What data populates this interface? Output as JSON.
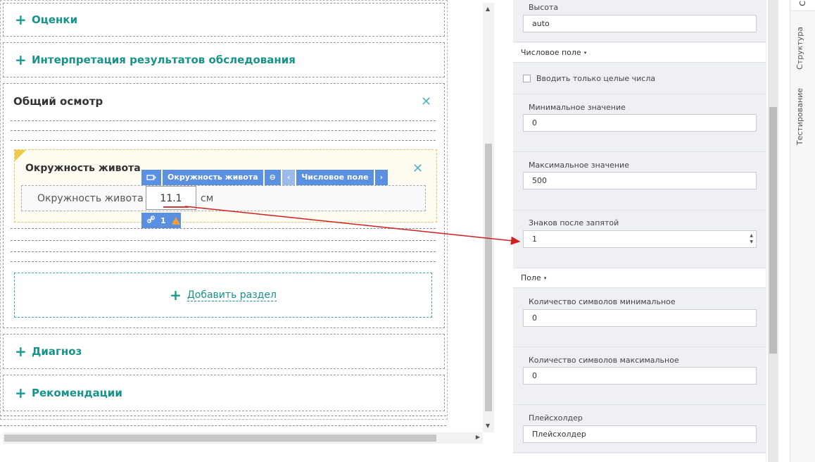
{
  "canvas": {
    "sections": [
      {
        "id": "ocenki",
        "plus": "+",
        "title": "Оценки"
      },
      {
        "id": "interpretation",
        "plus": "+",
        "title": "Интерпретация результатов обследования"
      },
      {
        "id": "diagnoz",
        "plus": "+",
        "title": "Диагноз"
      },
      {
        "id": "recommendations",
        "plus": "+",
        "title": "Рекомендации"
      }
    ],
    "general_exam": {
      "title": "Общий осмотр",
      "close": "✕",
      "field_block": {
        "title": "Окружность живота",
        "close": "✕",
        "row_label": "Окружность живота",
        "input_value": "11.1",
        "unit": "см"
      },
      "add_section": {
        "plus": "+",
        "label": "Добавить раздел"
      }
    },
    "toolbar": {
      "tag_icon": "tag-icon",
      "field_name": "Окружность живота",
      "minus_icon": "⊖",
      "prev_icon": "‹",
      "field_type": "Числовое поле",
      "next_icon": "›"
    },
    "badge": {
      "link_icon": "link-icon",
      "count": "1",
      "warning_icon": "warning-icon"
    },
    "accent_color": "#17948a",
    "toolbar_color": "#5b8fe0",
    "arrow_color": "#cc2222"
  },
  "properties": {
    "height": {
      "label": "Высота",
      "value": "auto"
    },
    "numeric_group": {
      "title": "Числовое поле",
      "caret": "▾"
    },
    "integers_only": {
      "label": "Вводить только целые числа",
      "checked": false
    },
    "min_value": {
      "label": "Минимальное значение",
      "value": "0"
    },
    "max_value": {
      "label": "Максимальное значение",
      "value": "500"
    },
    "decimals": {
      "label": "Знаков после запятой",
      "value": "1",
      "spin_up": "▲",
      "spin_down": "▼"
    },
    "field_group": {
      "title": "Поле",
      "caret": "▾"
    },
    "min_chars": {
      "label": "Количество символов минимальное",
      "value": "0"
    },
    "max_chars": {
      "label": "Количество символов максимальное",
      "value": "0"
    },
    "placeholder": {
      "label": "Плейсхолдер",
      "value": "Плейсхолдер"
    }
  },
  "side_tabs": [
    {
      "label": "С"
    },
    {
      "label": "Структура"
    },
    {
      "label": "Тестирование"
    }
  ]
}
